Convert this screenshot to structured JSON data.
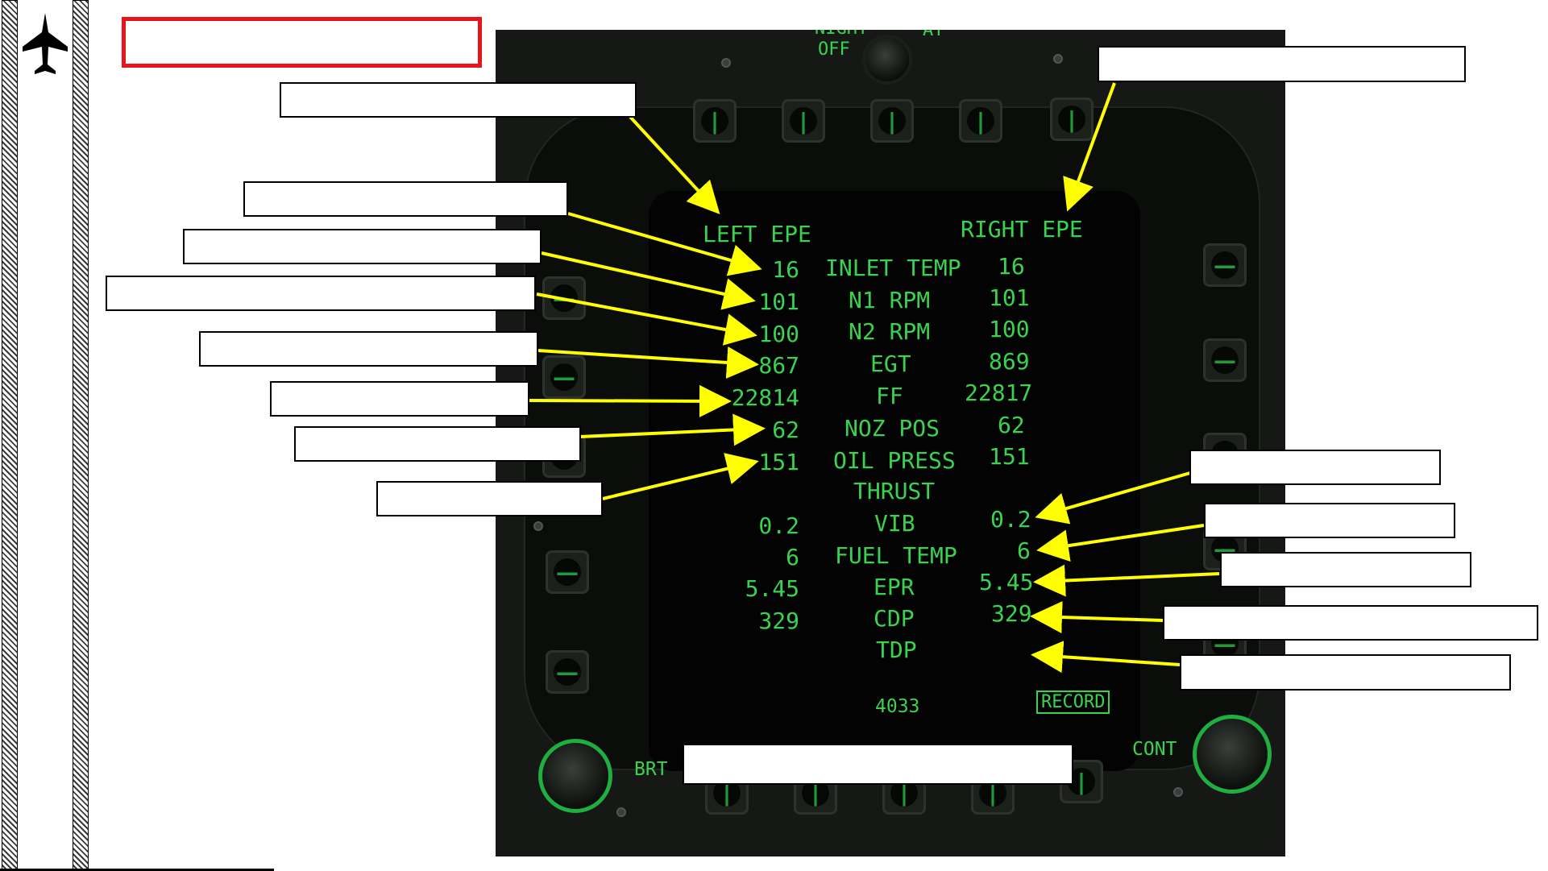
{
  "ddi": {
    "left_header": "LEFT EPE",
    "right_header": "RIGHT EPE",
    "rows": [
      {
        "param": "INLET TEMP",
        "left": "16",
        "right": "16"
      },
      {
        "param": "N1 RPM",
        "left": "101",
        "right": "101"
      },
      {
        "param": "N2 RPM",
        "left": "100",
        "right": "100"
      },
      {
        "param": "EGT",
        "left": "867",
        "right": "869"
      },
      {
        "param": "FF",
        "left": "22814",
        "right": "22817"
      },
      {
        "param": "NOZ POS",
        "left": "62",
        "right": "62"
      },
      {
        "param": "OIL PRESS",
        "left": "151",
        "right": "151"
      },
      {
        "param": "THRUST",
        "left": "",
        "right": ""
      },
      {
        "param": "VIB",
        "left": "0.2",
        "right": "0.2"
      },
      {
        "param": "FUEL TEMP",
        "left": "6",
        "right": "6"
      },
      {
        "param": "EPR",
        "left": "5.45",
        "right": "5.45"
      },
      {
        "param": "CDP",
        "left": "329",
        "right": "329"
      },
      {
        "param": "TDP",
        "left": "",
        "right": ""
      }
    ],
    "footer_number": "4033",
    "record_label": "RECORD",
    "brt_label": "BRT",
    "cont_label": "CONT",
    "night_label": "NIGHT",
    "off_label": "OFF",
    "day_label": "AY"
  },
  "colors": {
    "ddi_green": "#39d34e",
    "arrow_yellow": "#ffff00",
    "title_border_red": "#e8141c"
  },
  "icons": {
    "logo": "fighter-jet-icon"
  }
}
